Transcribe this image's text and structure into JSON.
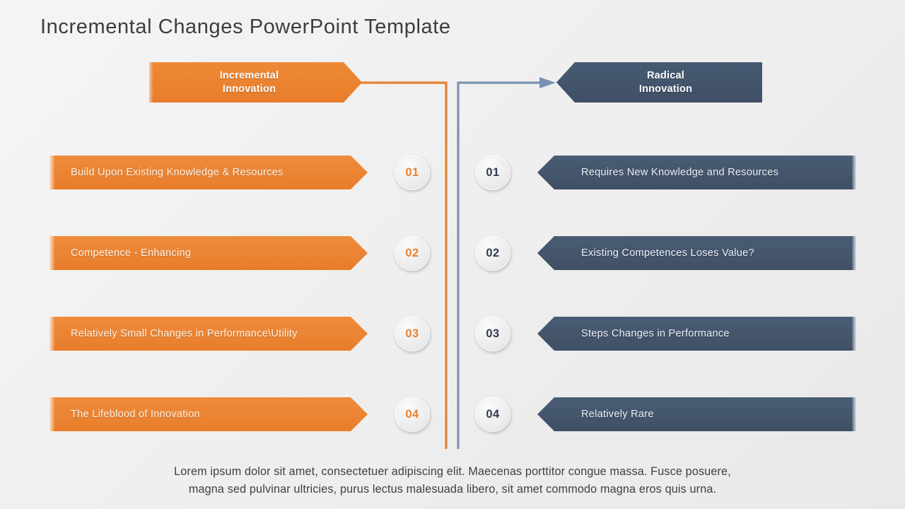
{
  "slide": {
    "title": "Incremental Changes PowerPoint Template",
    "colors": {
      "orange": "#e8802f",
      "slate": "#42536b",
      "orange_line": "#e8802f",
      "slate_line": "#7b92b4",
      "background": "#f0f0f0",
      "title_text": "#3d3d3d",
      "badge_face": "#ececec"
    }
  },
  "headers": {
    "left": {
      "line1": "Incremental",
      "line2": "Innovation"
    },
    "right": {
      "line1": "Radical",
      "line2": "Innovation"
    }
  },
  "rows": [
    {
      "number_left": "01",
      "number_right": "01",
      "left_label": "Build Upon Existing Knowledge & Resources",
      "right_label": "Requires New Knowledge and Resources"
    },
    {
      "number_left": "02",
      "number_right": "02",
      "left_label": "Competence - Enhancing",
      "right_label": "Existing Competences Loses Value?"
    },
    {
      "number_left": "03",
      "number_right": "03",
      "left_label": "Relatively Small Changes in Performance\\Utility",
      "right_label": "Steps Changes in Performance"
    },
    {
      "number_left": "04",
      "number_right": "04",
      "left_label": "The Lifeblood of Innovation",
      "right_label": "Relatively Rare"
    }
  ],
  "caption": {
    "line1": "Lorem ipsum dolor sit amet, consectetuer adipiscing elit. Maecenas porttitor congue massa. Fusce posuere,",
    "line2": "magna sed pulvinar ultricies, purus lectus malesuada libero, sit amet commodo magna eros quis urna."
  }
}
